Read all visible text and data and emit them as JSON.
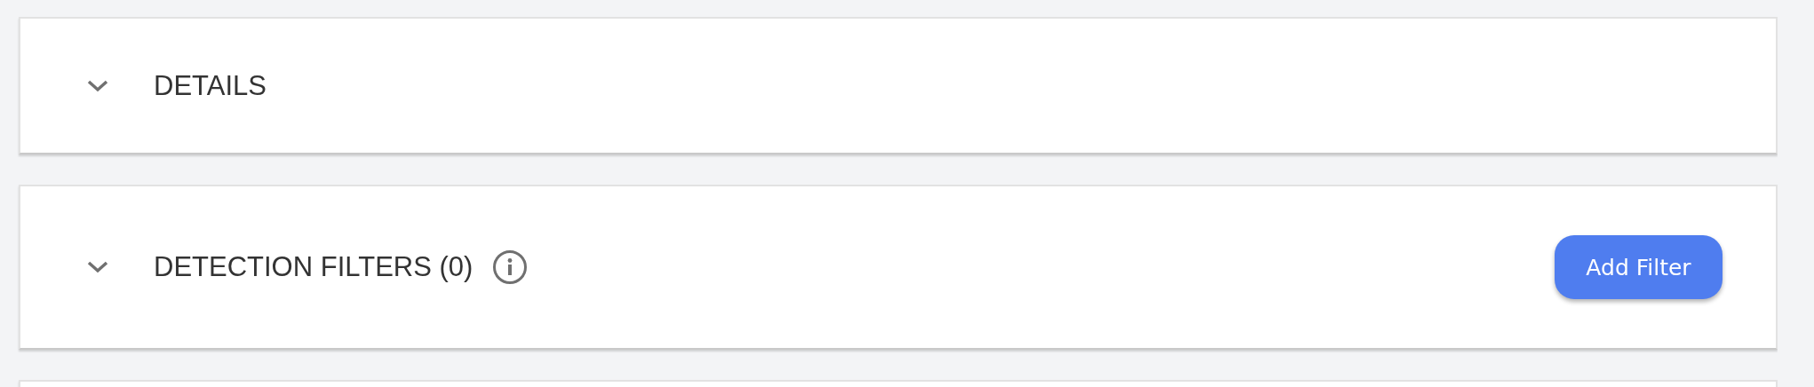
{
  "panels": [
    {
      "kind": "section",
      "title": "DETAILS",
      "expanded": false,
      "info": false
    },
    {
      "kind": "section",
      "title": "DETECTION FILTERS (0)",
      "expanded": false,
      "info": true,
      "action": "Add Filter"
    },
    {
      "kind": "blank"
    }
  ]
}
